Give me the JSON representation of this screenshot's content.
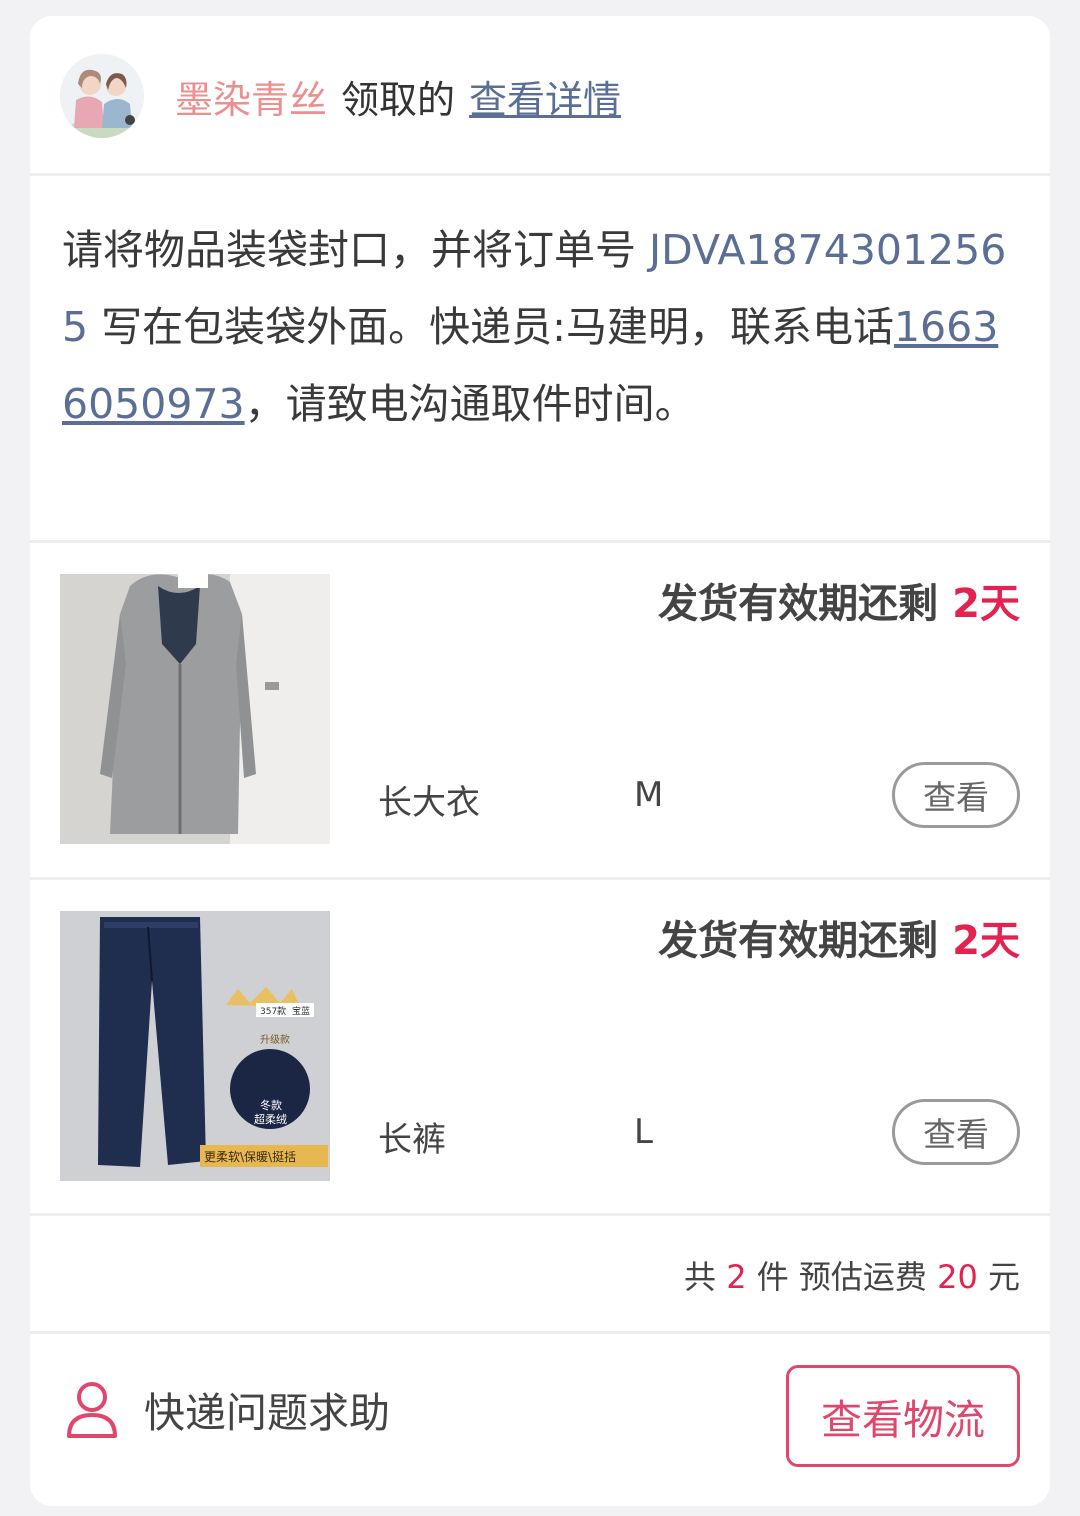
{
  "header": {
    "nickname": "墨染青丝",
    "claim_text": "领取的",
    "detail_link": "查看详情"
  },
  "message": {
    "part1": "请将物品装袋封口，并将订单号 ",
    "order_no": "JDVA18743012565",
    "part2": " 写在包装袋外面。快递员:马建明，联系电话",
    "phone": "16636050973",
    "part3": "，请致电沟通取件时间。"
  },
  "items": [
    {
      "deadline_prefix": "发货有效期还剩",
      "deadline_days": "2天",
      "name": "长大衣",
      "size": "M",
      "view_label": "查看"
    },
    {
      "deadline_prefix": "发货有效期还剩",
      "deadline_days": "2天",
      "name": "长裤",
      "size": "L",
      "view_label": "查看",
      "image_labels": [
        "357款",
        "宝蓝",
        "升级款",
        "冬款",
        "超柔绒",
        "更柔软\\保暖\\挺括"
      ]
    }
  ],
  "summary": {
    "pre_count": "共 ",
    "count": "2",
    "post_count": " 件 预估运费 ",
    "fee": "20",
    "unit": " 元"
  },
  "footer": {
    "help_text": "快递问题求助",
    "logistics_button": "查看物流"
  },
  "colors": {
    "accent": "#e3224f",
    "link": "#5b6f96",
    "nickname": "#eb8f8f",
    "button_border": "#e0476d"
  }
}
